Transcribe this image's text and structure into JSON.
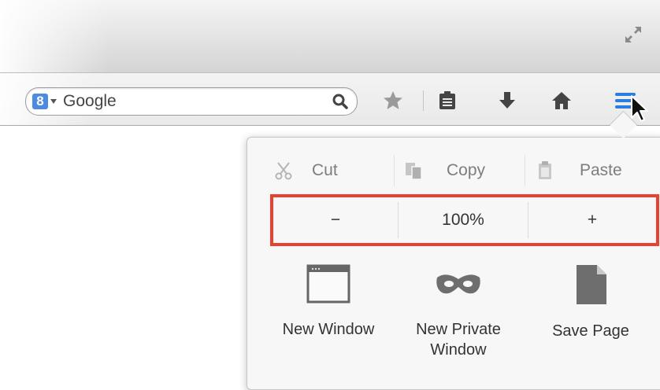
{
  "toolbar": {
    "search_engine_letter": "8",
    "search_placeholder": "Google",
    "icons": [
      "fullscreen-icon",
      "search-engine-icon",
      "magnifier-icon",
      "bookmark-star-icon",
      "bookmarks-menu-icon",
      "download-icon",
      "home-icon",
      "hamburger-menu-icon"
    ]
  },
  "menu_panel": {
    "edit": {
      "cut": "Cut",
      "copy": "Copy",
      "paste": "Paste"
    },
    "zoom": {
      "minus": "−",
      "level": "100%",
      "plus": "+"
    },
    "items": [
      {
        "label": "New Window"
      },
      {
        "label": "New Private Window"
      },
      {
        "label": "Save Page"
      }
    ],
    "highlight_color": "#e8412d"
  }
}
